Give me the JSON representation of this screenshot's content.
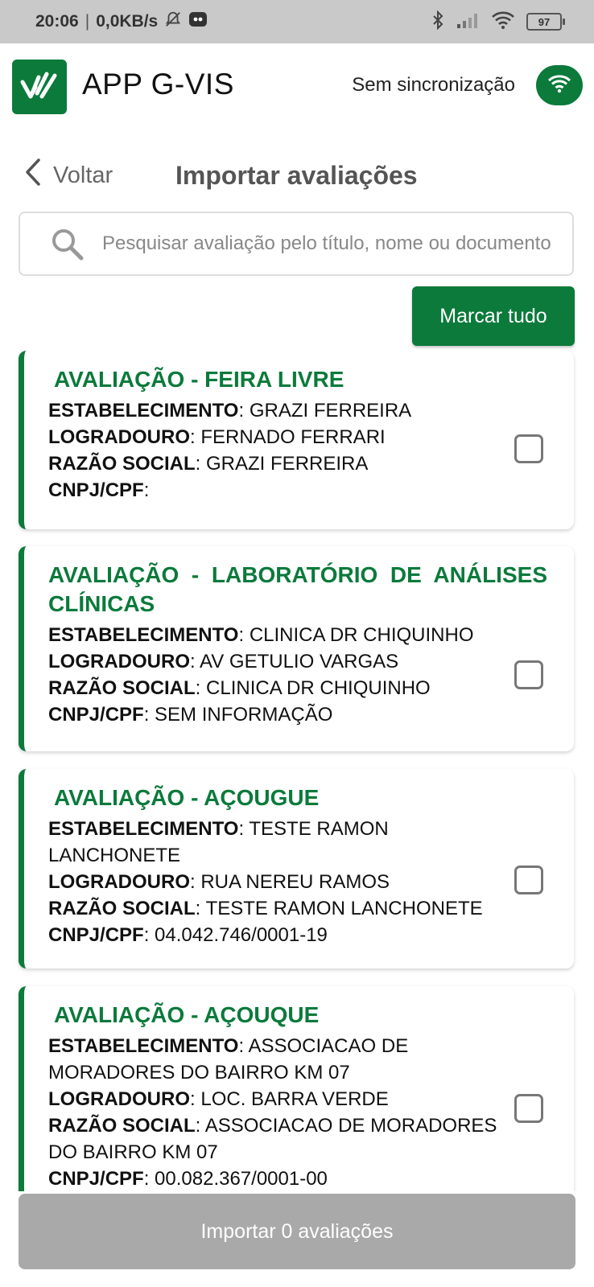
{
  "status_bar": {
    "time": "20:06",
    "speed": "0,0KB/s",
    "battery": "97"
  },
  "header": {
    "app_title": "APP G-VIS",
    "sync_label": "Sem sincronização"
  },
  "nav": {
    "back_label": "Voltar",
    "page_title": "Importar avaliações"
  },
  "search": {
    "placeholder": "Pesquisar avaliação pelo título, nome ou documento"
  },
  "mark_all_label": "Marcar tudo",
  "field_labels": {
    "establishment": "ESTABELECIMENTO",
    "street": "LOGRADOURO",
    "company": "RAZÃO SOCIAL",
    "doc": "CNPJ/CPF"
  },
  "cards": [
    {
      "title": "AVALIAÇÃO - FEIRA LIVRE",
      "establishment": "GRAZI FERREIRA",
      "street": "FERNADO FERRARI",
      "company": "GRAZI FERREIRA",
      "doc": "",
      "checked": false
    },
    {
      "title": "AVALIAÇÃO - LABORATÓRIO DE ANÁLISES CLÍNICAS",
      "establishment": "CLINICA DR CHIQUINHO",
      "street": "AV GETULIO VARGAS",
      "company": "CLINICA DR CHIQUINHO",
      "doc": "SEM INFORMAÇÃO",
      "checked": false
    },
    {
      "title": "AVALIAÇÃO - AÇOUGUE",
      "establishment": "TESTE RAMON LANCHONETE",
      "street": "RUA NEREU RAMOS",
      "company": "TESTE RAMON LANCHONETE",
      "doc": "04.042.746/0001-19",
      "checked": false
    },
    {
      "title": "AVALIAÇÃO - AÇOUQUE",
      "establishment": "ASSOCIACAO DE MORADORES DO BAIRRO KM 07",
      "street": "LOC. BARRA VERDE",
      "company": "ASSOCIACAO DE MORADORES DO BAIRRO KM 07",
      "doc": "00.082.367/0001-00",
      "checked": false
    }
  ],
  "import_button_label": "Importar 0 avaliações",
  "colors": {
    "brand": "#0b7a3b",
    "disabled": "#a9a9a9"
  }
}
